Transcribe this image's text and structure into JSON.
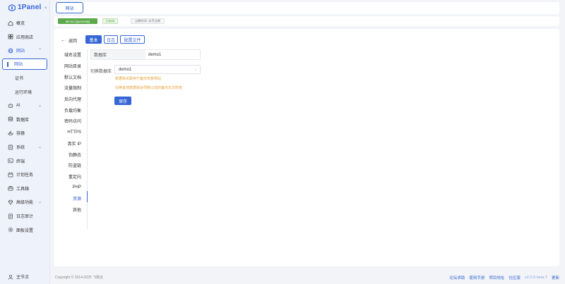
{
  "app": {
    "logo_text": "1Panel"
  },
  "sidebar": {
    "items": [
      {
        "label": "概览",
        "icon": "home-icon"
      },
      {
        "label": "应用商店",
        "icon": "grid-icon"
      },
      {
        "label": "网站",
        "icon": "globe-icon",
        "open": true,
        "children": [
          {
            "label": "网站",
            "active": true
          },
          {
            "label": "证书"
          },
          {
            "label": "运行环境"
          }
        ]
      },
      {
        "label": "AI",
        "icon": "ai-icon",
        "chevron": true
      },
      {
        "label": "数据库",
        "icon": "database-icon"
      },
      {
        "label": "容器",
        "icon": "container-icon"
      },
      {
        "label": "系统",
        "icon": "system-icon",
        "chevron": true
      },
      {
        "label": "终端",
        "icon": "terminal-icon"
      },
      {
        "label": "计划任务",
        "icon": "calendar-icon"
      },
      {
        "label": "工具箱",
        "icon": "toolbox-icon"
      },
      {
        "label": "高级功能",
        "icon": "diamond-icon",
        "chevron": true
      },
      {
        "label": "日志审计",
        "icon": "log-icon"
      },
      {
        "label": "面板设置",
        "icon": "settings-icon"
      }
    ],
    "footer": {
      "label": "主节点",
      "icon": "user-icon"
    }
  },
  "topbar": {
    "tab_label": "网站"
  },
  "infobar": {
    "site_tag": "demo1 [openresty]",
    "status_tag": "已启动",
    "expire_tag": "过期时间: 永不过期"
  },
  "main": {
    "back_label": "返回",
    "buttons": {
      "base": "基本",
      "log": "日志",
      "config": "配置文件"
    },
    "menu": [
      "域名设置",
      "网站目录",
      "默认文档",
      "流量限制",
      "反向代理",
      "负载均衡",
      "密码访问",
      "HTTPS",
      "真实 IP",
      "伪静态",
      "防盗链",
      "重定向",
      "PHP",
      "资源",
      "其他"
    ],
    "active_menu_index": 13,
    "database": {
      "label": "数据库",
      "value": "demo1"
    },
    "switch": {
      "label": "切换数据库",
      "selected": "demo1",
      "tip1": "数据库关联用于备份恢复网站",
      "tip2": "切换其他数据库会导致以前的备份无法恢复"
    },
    "save_label": "保存"
  },
  "footer": {
    "copyright": "Copyright © 2014-2025 飞致云",
    "links": [
      "论坛求助",
      "使用手册",
      "项目地址",
      "社区版"
    ],
    "version": "v2.0.0-beta.7",
    "update": "更新"
  },
  "colors": {
    "accent": "#3566d6",
    "success": "#5aa84a",
    "warning": "#e6a23c"
  }
}
